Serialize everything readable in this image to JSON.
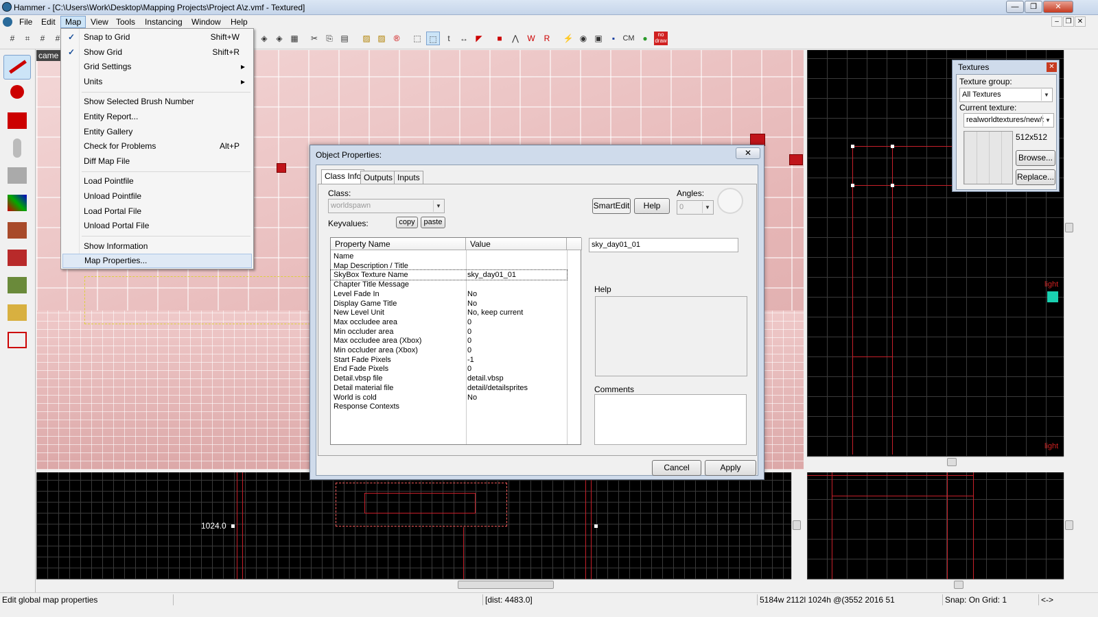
{
  "window": {
    "title": "Hammer - [C:\\Users\\Work\\Desktop\\Mapping Projects\\Project A\\z.vmf - Textured]"
  },
  "menubar": {
    "items": [
      "File",
      "Edit",
      "Map",
      "View",
      "Tools",
      "Instancing",
      "Window",
      "Help"
    ]
  },
  "map_menu": {
    "items": [
      {
        "label": "Snap to Grid",
        "shortcut": "Shift+W",
        "checked": true
      },
      {
        "label": "Show Grid",
        "shortcut": "Shift+R",
        "checked": true
      },
      {
        "label": "Grid Settings",
        "submenu": true
      },
      {
        "label": "Units",
        "submenu": true
      },
      {
        "label": "Show Selected Brush Number"
      },
      {
        "label": "Entity Report..."
      },
      {
        "label": "Entity Gallery"
      },
      {
        "label": "Check for Problems",
        "shortcut": "Alt+P"
      },
      {
        "label": "Diff Map File"
      },
      {
        "label": "Load Pointfile"
      },
      {
        "label": "Unload Pointfile"
      },
      {
        "label": "Load Portal File"
      },
      {
        "label": "Unload Portal File"
      },
      {
        "label": "Show Information"
      },
      {
        "label": "Map Properties...",
        "highlighted": true
      }
    ],
    "check_glyph": "✓",
    "arrow_glyph": "▸"
  },
  "toolbar": {
    "cm_label": "CM",
    "nodraw_label": "no draw"
  },
  "view3d": {
    "label": "came"
  },
  "view2d_bottom_left": {
    "coord_label": "1024.0"
  },
  "view2d_top_right": {
    "entity_label": "light",
    "entity_label2": "light"
  },
  "object_properties": {
    "title": "Object Properties:",
    "close": "✕",
    "tabs": [
      "Class Info",
      "Outputs",
      "Inputs"
    ],
    "class_label": "Class:",
    "class_value": "worldspawn",
    "keyvalues_label": "Keyvalues:",
    "copy": "copy",
    "paste": "paste",
    "smartedit": "SmartEdit",
    "help_button": "Help",
    "angles_label": "Angles:",
    "angles_value": "0",
    "value_field": "sky_day01_01",
    "help_label": "Help",
    "comments_label": "Comments",
    "cancel": "Cancel",
    "apply": "Apply",
    "columns": [
      "Property Name",
      "Value"
    ],
    "rows": [
      {
        "name": "Name",
        "value": ""
      },
      {
        "name": "Map Description / Title",
        "value": ""
      },
      {
        "name": "SkyBox Texture Name",
        "value": "sky_day01_01",
        "selected": true
      },
      {
        "name": "Chapter Title Message",
        "value": ""
      },
      {
        "name": "Level Fade In",
        "value": "No"
      },
      {
        "name": "Display Game Title",
        "value": "No"
      },
      {
        "name": "New Level Unit",
        "value": "No, keep current"
      },
      {
        "name": "Max occludee area",
        "value": "0"
      },
      {
        "name": "Min occluder area",
        "value": "0"
      },
      {
        "name": "Max occludee area (Xbox)",
        "value": "0"
      },
      {
        "name": "Min occluder area (Xbox)",
        "value": "0"
      },
      {
        "name": "Start Fade Pixels",
        "value": "-1"
      },
      {
        "name": "End Fade Pixels",
        "value": "0"
      },
      {
        "name": "Detail.vbsp file",
        "value": "detail.vbsp"
      },
      {
        "name": "Detail material file",
        "value": "detail/detailsprites"
      },
      {
        "name": "World is cold",
        "value": "No"
      },
      {
        "name": "Response Contexts",
        "value": ""
      }
    ]
  },
  "textures": {
    "title": "Textures",
    "close": "✕",
    "group_label": "Texture group:",
    "group_value": "All Textures",
    "current_label": "Current texture:",
    "current_value": "realworldtextures/new/t",
    "size": "512x512",
    "browse": "Browse...",
    "replace": "Replace..."
  },
  "statusbar": {
    "message": "Edit global map properties",
    "dist": "[dist: 4483.0]",
    "dims": "5184w 2112l 1024h @(3552 2016 51",
    "snap": "Snap: On Grid: 1",
    "arrows": "<->"
  },
  "window_controls": {
    "minimize": "—",
    "maximize": "❐",
    "close": "✕",
    "mdi_min": "–",
    "mdi_restore": "❐",
    "mdi_close": "✕"
  },
  "colors": {
    "accent": "#cce4f7",
    "grid_line": "#3a3a3a",
    "brush_red": "#c8202a",
    "viewport_pink": "#e6b6b6"
  }
}
